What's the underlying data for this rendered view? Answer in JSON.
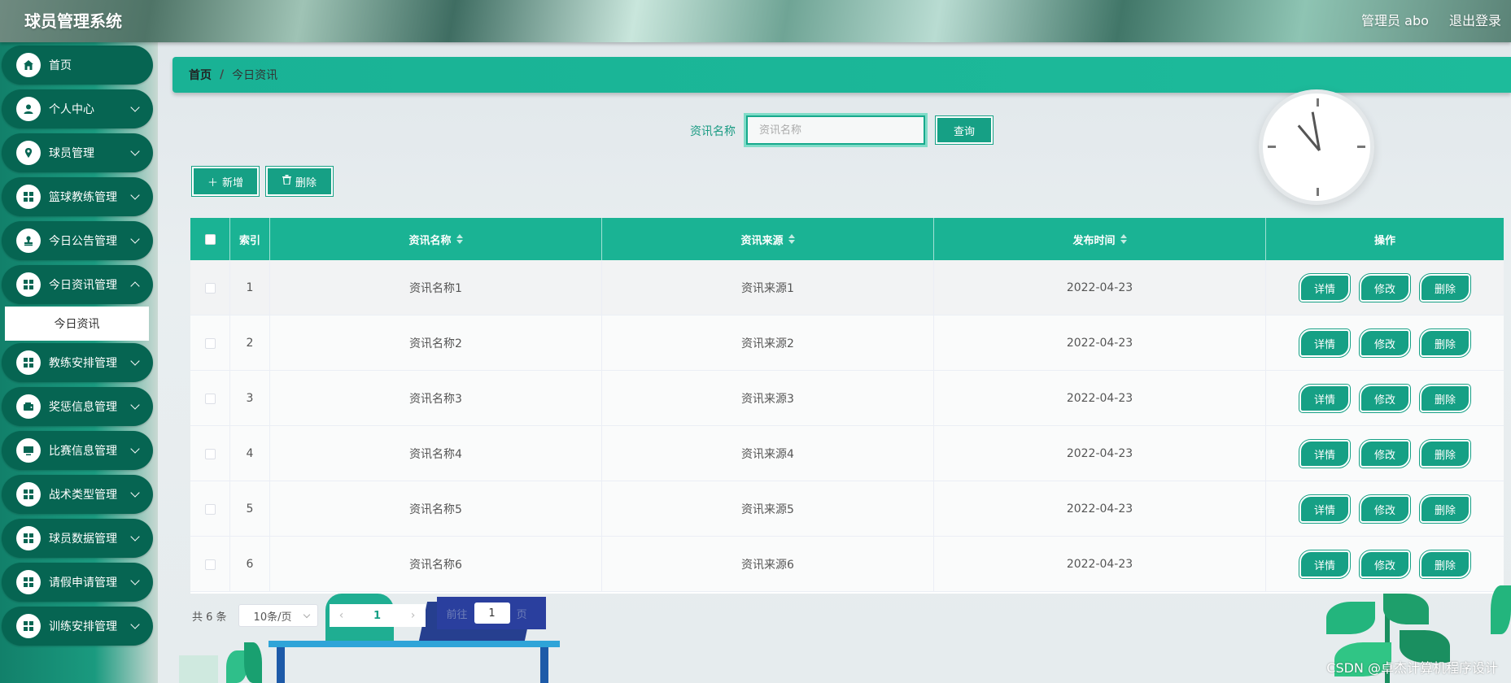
{
  "header": {
    "app_title": "球员管理系统",
    "user_label": "管理员 abo",
    "logout_label": "退出登录"
  },
  "sidebar": {
    "items": [
      {
        "label": "首页",
        "icon": "home-icon",
        "has_arrow": false
      },
      {
        "label": "个人中心",
        "icon": "user-icon",
        "has_arrow": true
      },
      {
        "label": "球员管理",
        "icon": "location-icon",
        "has_arrow": true
      },
      {
        "label": "篮球教练管理",
        "icon": "grid-icon",
        "has_arrow": true
      },
      {
        "label": "今日公告管理",
        "icon": "stamp-icon",
        "has_arrow": true
      },
      {
        "label": "今日资讯管理",
        "icon": "grid-icon",
        "has_arrow": true
      },
      {
        "label": "教练安排管理",
        "icon": "grid-icon",
        "has_arrow": true
      },
      {
        "label": "奖惩信息管理",
        "icon": "wallet-icon",
        "has_arrow": true
      },
      {
        "label": "比赛信息管理",
        "icon": "monitor-icon",
        "has_arrow": true
      },
      {
        "label": "战术类型管理",
        "icon": "grid-icon",
        "has_arrow": true
      },
      {
        "label": "球员数据管理",
        "icon": "grid-icon",
        "has_arrow": true
      },
      {
        "label": "请假申请管理",
        "icon": "grid-icon",
        "has_arrow": true
      },
      {
        "label": "训练安排管理",
        "icon": "grid-icon",
        "has_arrow": true
      }
    ],
    "active_submenu": "今日资讯"
  },
  "breadcrumb": {
    "home": "首页",
    "separator": "/",
    "current": "今日资讯"
  },
  "search": {
    "label": "资讯名称",
    "placeholder": "资讯名称",
    "button": "查询"
  },
  "actions": {
    "add": "新增",
    "delete": "删除"
  },
  "table": {
    "columns": [
      "索引",
      "资讯名称",
      "资讯来源",
      "发布时间",
      "操作"
    ],
    "rows": [
      {
        "index": "1",
        "name": "资讯名称1",
        "source": "资讯来源1",
        "time": "2022-04-23"
      },
      {
        "index": "2",
        "name": "资讯名称2",
        "source": "资讯来源2",
        "time": "2022-04-23"
      },
      {
        "index": "3",
        "name": "资讯名称3",
        "source": "资讯来源3",
        "time": "2022-04-23"
      },
      {
        "index": "4",
        "name": "资讯名称4",
        "source": "资讯来源4",
        "time": "2022-04-23"
      },
      {
        "index": "5",
        "name": "资讯名称5",
        "source": "资讯来源5",
        "time": "2022-04-23"
      },
      {
        "index": "6",
        "name": "资讯名称6",
        "source": "资讯来源6",
        "time": "2022-04-23"
      }
    ],
    "row_actions": [
      "详情",
      "修改",
      "删除"
    ]
  },
  "pagination": {
    "total": "共 6 条",
    "page_size": "10条/页",
    "current_page": "1",
    "goto_prefix": "前往",
    "goto_value": "1",
    "goto_suffix": "页"
  },
  "colors": {
    "accent": "#16a085",
    "sidebar_item": "#066552",
    "header_bg": "#1ab394"
  },
  "watermark": "CSDN @卓杰计算机程序设计"
}
